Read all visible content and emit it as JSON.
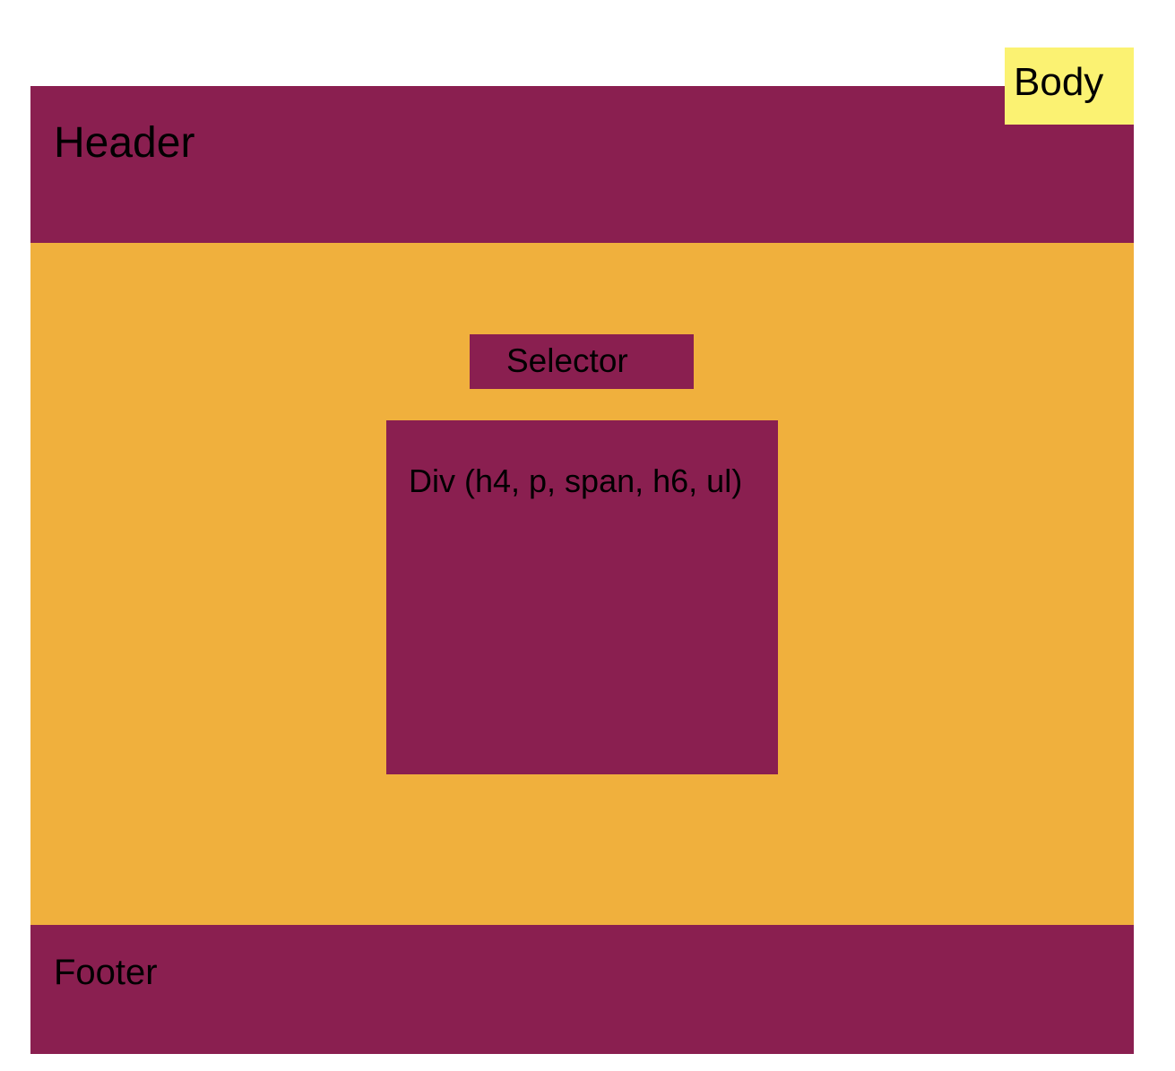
{
  "header": {
    "label": "Header"
  },
  "main": {
    "selector": {
      "label": "Selector"
    },
    "div_box": {
      "label": "Div (h4, p, span, h6, ul)"
    }
  },
  "footer": {
    "label": "Footer"
  },
  "body_tag": {
    "label": "Body"
  },
  "colors": {
    "header": "#8a1f50",
    "main": "#f0b03d",
    "selector": "#8a1f50",
    "div_box": "#8a1f50",
    "footer": "#8a1f50",
    "body_tag": "#fbf272",
    "background": "#ffffff",
    "text": "#000000"
  }
}
